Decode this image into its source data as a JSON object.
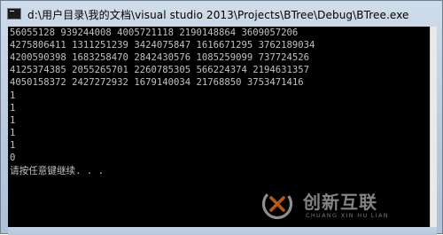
{
  "window": {
    "title": "d:\\用户目录\\我的文档\\visual studio 2013\\Projects\\BTree\\Debug\\BTree.exe",
    "icon": "console-app-icon"
  },
  "console": {
    "lines": [
      "56055128 939244008 4005721118 2190148864 3609057206",
      "4275806411 1311251239 3424075847 1616671295 3762189034",
      "4200590398 1683258470 2842430576 1085259099 737724526",
      "4125374385 2055265701 2260785305 566224374 2194631357",
      "4050158372 2427272932 1679140034 21768850 3753471416",
      "1",
      "1",
      "1",
      "1",
      "1",
      "0",
      "请按任意键继续. . ."
    ]
  },
  "watermark": {
    "brand_cn": "创新互联",
    "brand_en": "CHUANG XIN HU LIAN"
  }
}
